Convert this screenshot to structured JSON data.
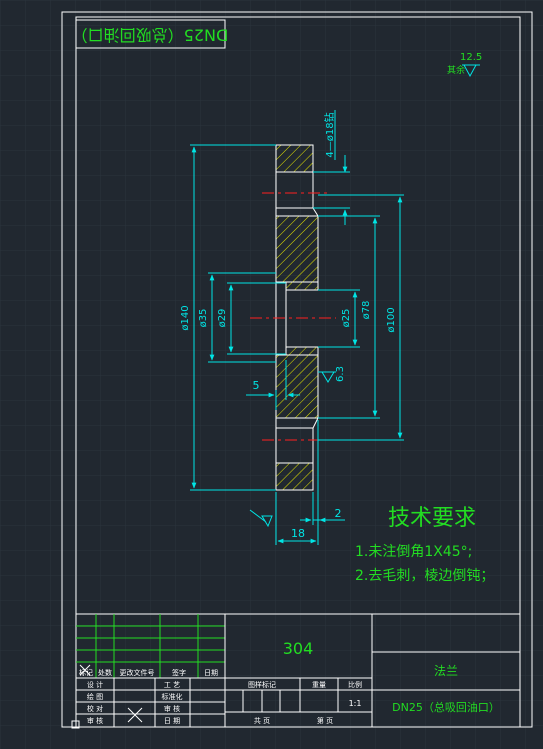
{
  "colors": {
    "background": "#212830",
    "grid": "#2b343d",
    "frame": "#ffffff",
    "dimension": "#00e5e5",
    "outline": "#ffffff",
    "hatch": "#e6e600",
    "centerline": "#ff2020",
    "text_green": "#22dd22",
    "title_text": "#22dd22"
  },
  "drawing": {
    "rotated_title": "DN25（总吸回油口）",
    "roughness_value": "12.5",
    "roughness_label": "其余",
    "hole_callout": "4—ø18钻",
    "dim_d140": "ø140",
    "dim_d35": "ø35",
    "dim_d29": "ø29",
    "dim_d25": "ø25",
    "dim_d78": "ø78",
    "dim_d100": "ø100",
    "dim_5": "5",
    "dim_2": "2",
    "dim_18": "18",
    "surface_6_3": "6.3"
  },
  "requirements": {
    "heading": "技术要求",
    "line1": "1.未注倒角1X45°;",
    "line2": "2.去毛刺，棱边倒钝；"
  },
  "title_block": {
    "material": "304",
    "part_name": "法兰",
    "drawing_title": "DN25（总吸回油口）",
    "header_cells": [
      "标记",
      "处数",
      "更改文件号",
      "签字",
      "日期"
    ],
    "left_rows": [
      [
        "设 计",
        "工 艺"
      ],
      [
        "绘 图",
        "标准化"
      ],
      [
        "校 对",
        "审 核"
      ],
      [
        "审 核",
        "日 期"
      ]
    ],
    "stage_label": "图样标记",
    "weight_label": "重量",
    "scale_label": "比例",
    "scale_value": "1:1",
    "sheet_total": "共  页",
    "sheet_no": "第  页"
  }
}
